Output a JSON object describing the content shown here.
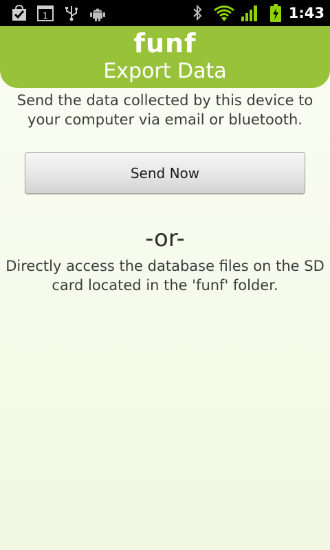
{
  "status_bar": {
    "time": "1:43",
    "calendar_day": "1",
    "icons": [
      "checkbox-bag-icon",
      "calendar-icon",
      "usb-icon",
      "android-icon",
      "bluetooth-icon",
      "wifi-icon",
      "signal-icon",
      "battery-charging-icon"
    ]
  },
  "header": {
    "logo_text": "funf",
    "title": "Export Data"
  },
  "main": {
    "description": "Send the data collected by this device to your computer via email or bluetooth.",
    "send_button_label": "Send Now",
    "separator": "-or-",
    "direct_access_text": "Directly access the database files on the SD card located in the 'funf' folder."
  },
  "colors": {
    "header_green": "#99c23b",
    "background": "#f6faeb",
    "accent_signal": "#8fd400"
  }
}
